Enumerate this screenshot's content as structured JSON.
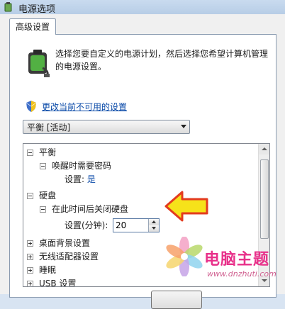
{
  "window": {
    "title": "电源选项"
  },
  "tabs": [
    {
      "label": "高级设置"
    }
  ],
  "header": {
    "description": "选择您要自定义的电源计划，然后选择您希望计算机管理的电源设置。"
  },
  "change_link": "更改当前不可用的设置",
  "plan_select": {
    "value": "平衡 [活动]"
  },
  "tree": {
    "balance": {
      "label": "平衡"
    },
    "wake_password": {
      "label": "唤醒时需要密码"
    },
    "wake_password_setting": {
      "label": "设置:",
      "value": "是"
    },
    "hard_disk": {
      "label": "硬盘"
    },
    "turn_off_disk": {
      "label": "在此时间后关闭硬盘"
    },
    "minutes_setting": {
      "label": "设置(分钟):",
      "value": "20"
    },
    "desktop_background": {
      "label": "桌面背景设置"
    },
    "wireless_adapter": {
      "label": "无线适配器设置"
    },
    "sleep": {
      "label": "睡眠"
    },
    "usb": {
      "label": "USB 设置"
    }
  },
  "watermark": {
    "title": "电脑主题",
    "url": "www.dnzhuti.com"
  },
  "colors": {
    "link": "#0a4aa8",
    "arrow_fill": "#f6e21a",
    "arrow_stroke": "#e33b1e",
    "watermark": "#e8308a"
  }
}
